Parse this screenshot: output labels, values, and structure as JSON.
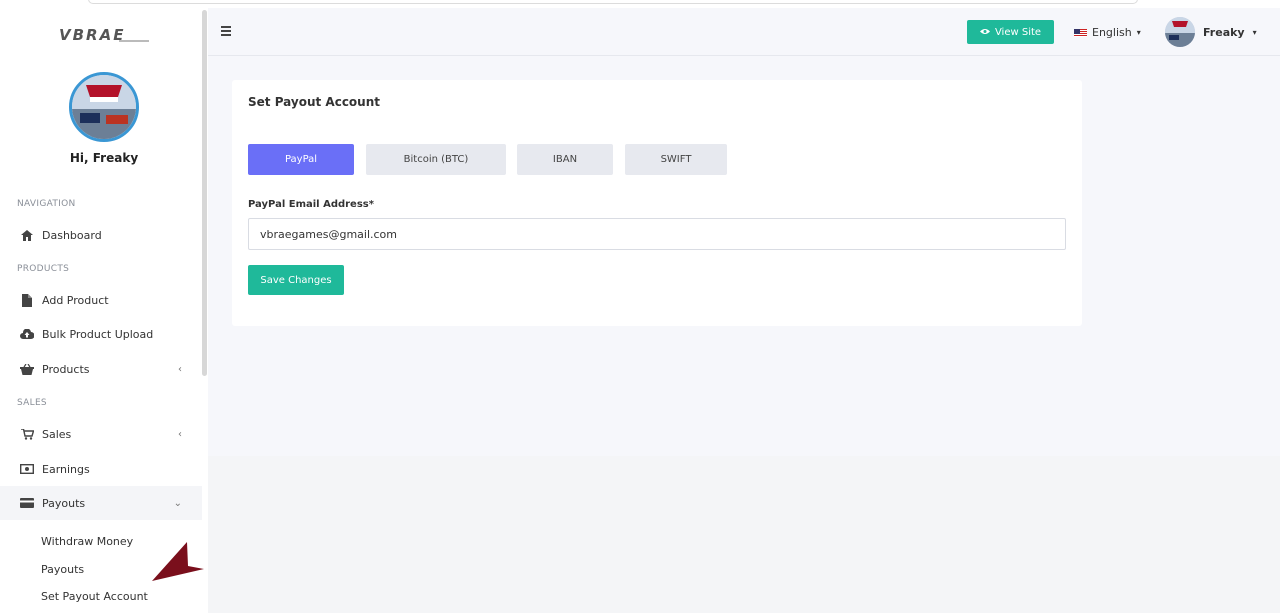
{
  "brand": {
    "logo_text": "VBRAE"
  },
  "sidebar": {
    "greeting": "Hi, Freaky",
    "sections": {
      "navigation": "NAVIGATION",
      "products": "PRODUCTS",
      "sales": "SALES"
    },
    "items": [
      {
        "label": "Dashboard",
        "icon": "home-icon"
      },
      {
        "label": "Add Product",
        "icon": "file-icon"
      },
      {
        "label": "Bulk Product Upload",
        "icon": "cloud-upload-icon"
      },
      {
        "label": "Products",
        "icon": "basket-icon"
      },
      {
        "label": "Sales",
        "icon": "cart-icon"
      },
      {
        "label": "Earnings",
        "icon": "money-icon"
      },
      {
        "label": "Payouts",
        "icon": "credit-card-icon"
      }
    ],
    "payout_sub": [
      "Withdraw Money",
      "Payouts",
      "Set Payout Account"
    ]
  },
  "topbar": {
    "view_site": "View Site",
    "language": "English",
    "username": "Freaky"
  },
  "card": {
    "title": "Set Payout Account",
    "tabs": [
      "PayPal",
      "Bitcoin (BTC)",
      "IBAN",
      "SWIFT"
    ],
    "active_tab": "PayPal",
    "field_label": "PayPal Email Address*",
    "field_value": "vbraegames@gmail.com",
    "save_label": "Save Changes"
  },
  "colors": {
    "accent": "#1fb99a",
    "tab_active": "#6a6ff7",
    "arrow": "#7a0f1c"
  }
}
